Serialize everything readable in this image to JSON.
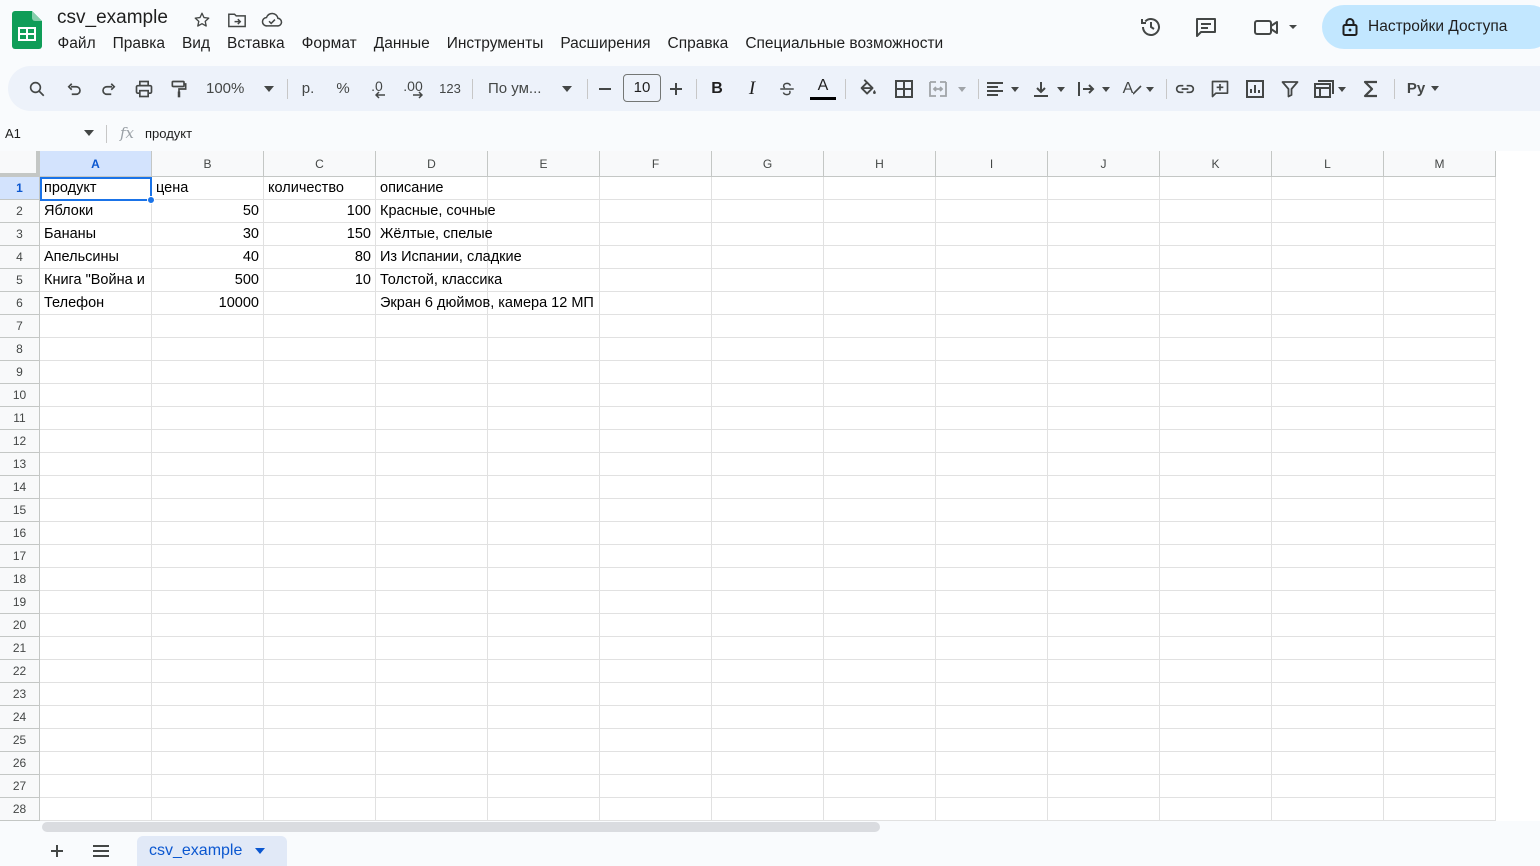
{
  "app": {
    "doc_title": "csv_example",
    "share_label": "Настройки Доступа",
    "accent_color": "#0b57d0",
    "share_bg_color": "#c2e7ff"
  },
  "title_icons": [
    "star-icon",
    "move-to-folder-icon",
    "cloud-saved-icon"
  ],
  "top_right_icons": [
    "version-history-icon",
    "comments-icon",
    "meet-video-icon",
    "lock-icon"
  ],
  "menu": [
    "Файл",
    "Правка",
    "Вид",
    "Вставка",
    "Формат",
    "Данные",
    "Инструменты",
    "Расширения",
    "Справка",
    "Специальные возможности"
  ],
  "toolbar": {
    "zoom": "100%",
    "currency": "р.",
    "percent": "%",
    "decrease_decimal": ".0",
    "increase_decimal": ".00",
    "more_formats": "123",
    "font": "По ум...",
    "font_size": "10",
    "bold": "B",
    "italic": "I",
    "text_color": "A",
    "text_rotation": "A",
    "input_tools": "Ру"
  },
  "formula_bar": {
    "name_box": "A1",
    "fx": "fx",
    "value": "продукт"
  },
  "columns": [
    "A",
    "B",
    "C",
    "D",
    "E",
    "F",
    "G",
    "H",
    "I",
    "J",
    "K",
    "L",
    "M"
  ],
  "rows": [
    "1",
    "2",
    "3",
    "4",
    "5",
    "6",
    "7",
    "8",
    "9",
    "10",
    "11",
    "12",
    "13",
    "14",
    "15",
    "16",
    "17",
    "18",
    "19",
    "20",
    "21",
    "22",
    "23",
    "24",
    "25",
    "26",
    "27",
    "28"
  ],
  "selected_cell": "A1",
  "table": [
    [
      "продукт",
      "цена",
      "количество",
      "описание"
    ],
    [
      "Яблоки",
      "50",
      "100",
      "Красные, сочные"
    ],
    [
      "Бананы",
      "30",
      "150",
      "Жёлтые, спелые"
    ],
    [
      "Апельсины",
      "40",
      "80",
      "Из Испании, сладкие"
    ],
    [
      "Книга \"Война и",
      "500",
      "10",
      "Толстой, классика"
    ],
    [
      "Телефон",
      "10000",
      "",
      "Экран 6 дюймов, камера 12 МП"
    ]
  ],
  "sheets": [
    {
      "name": "csv_example",
      "active": true
    }
  ]
}
